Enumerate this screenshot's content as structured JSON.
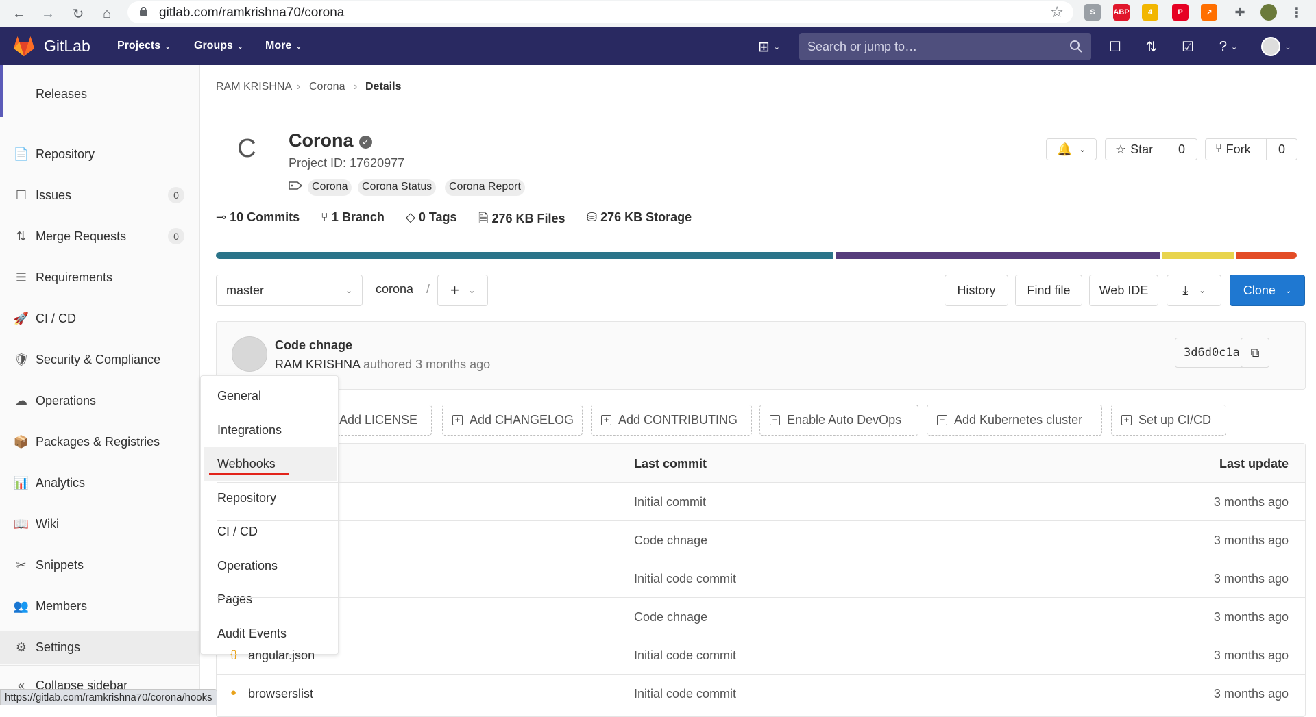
{
  "browser": {
    "url": "gitlab.com/ramkrishna70/corona",
    "status_url": "https://gitlab.com/ramkrishna70/corona/hooks",
    "extensions": [
      {
        "name": "skype-extension-icon",
        "label": "S",
        "color": "#9aa0a6"
      },
      {
        "name": "adblock-plus-icon",
        "label": "ABP",
        "color": "#e0162b"
      },
      {
        "name": "extension-badge-icon",
        "label": "4",
        "color": "#f2b600"
      },
      {
        "name": "pinterest-icon",
        "label": "P",
        "color": "#e60023"
      },
      {
        "name": "chart-extension-icon",
        "label": "↗",
        "color": "#ff6f00"
      }
    ]
  },
  "header": {
    "logo_text": "GitLab",
    "nav": [
      "Projects",
      "Groups",
      "More"
    ],
    "search_placeholder": "Search or jump to…"
  },
  "sidebar": {
    "top_partial": "Releases",
    "items": [
      {
        "name": "repository",
        "label": "Repository",
        "icon": "📄"
      },
      {
        "name": "issues",
        "label": "Issues",
        "icon": "☐",
        "count": "0"
      },
      {
        "name": "merge-requests",
        "label": "Merge Requests",
        "icon": "⇅",
        "count": "0"
      },
      {
        "name": "requirements",
        "label": "Requirements",
        "icon": "☰"
      },
      {
        "name": "ci-cd",
        "label": "CI / CD",
        "icon": "🚀"
      },
      {
        "name": "security-compliance",
        "label": "Security & Compliance",
        "icon": "🛡"
      },
      {
        "name": "operations",
        "label": "Operations",
        "icon": "☁"
      },
      {
        "name": "packages-registries",
        "label": "Packages & Registries",
        "icon": "📦"
      },
      {
        "name": "analytics",
        "label": "Analytics",
        "icon": "📊"
      },
      {
        "name": "wiki",
        "label": "Wiki",
        "icon": "📖"
      },
      {
        "name": "snippets",
        "label": "Snippets",
        "icon": "✂"
      },
      {
        "name": "members",
        "label": "Members",
        "icon": "👥"
      },
      {
        "name": "settings",
        "label": "Settings",
        "icon": "⚙"
      }
    ],
    "collapse_label": "Collapse sidebar"
  },
  "flyout": {
    "items": [
      "General",
      "Integrations",
      "Webhooks",
      "Repository",
      "CI / CD",
      "Operations",
      "Pages",
      "Audit Events"
    ]
  },
  "breadcrumb": [
    "RAM KRISHNA",
    "Corona",
    "Details"
  ],
  "project": {
    "avatar_letter": "C",
    "name": "Corona",
    "id_text": "Project ID: 17620977",
    "topics": [
      "Corona",
      "Corona Status",
      "Corona Report"
    ],
    "star_label": "Star",
    "star_count": "0",
    "fork_label": "Fork",
    "fork_count": "0"
  },
  "stats": [
    {
      "value": "10",
      "label": "Commits"
    },
    {
      "value": "1",
      "label": "Branch"
    },
    {
      "value": "0",
      "label": "Tags"
    },
    {
      "value": "276 KB",
      "label": "Files"
    },
    {
      "value": "276 KB",
      "label": "Storage"
    }
  ],
  "languages": [
    {
      "color": "#2b7489",
      "share": 0.57
    },
    {
      "color": "#563d7c",
      "share": 0.3
    },
    {
      "color": "#e8d44d",
      "share": 0.066
    },
    {
      "color": "#e34c26",
      "share": 0.056
    }
  ],
  "toolbar": {
    "branch": "master",
    "path": "corona",
    "path_sep": "/",
    "history": "History",
    "find_file": "Find file",
    "web_ide": "Web IDE",
    "clone": "Clone"
  },
  "last_commit": {
    "title": "Code chnage",
    "author": "RAM KRISHNA",
    "meta": "authored 3 months ago",
    "sha": "3d6d0c1a"
  },
  "add_buttons": [
    "Add LICENSE",
    "Add CHANGELOG",
    "Add CONTRIBUTING",
    "Enable Auto DevOps",
    "Add Kubernetes cluster",
    "Set up CI/CD"
  ],
  "table": {
    "col_last_commit": "Last commit",
    "col_last_update": "Last update",
    "rows": [
      {
        "name": "",
        "commit": "Initial commit",
        "date": "3 months ago"
      },
      {
        "name": "",
        "commit": "Code chnage",
        "date": "3 months ago"
      },
      {
        "name": "",
        "commit": "Initial code commit",
        "date": "3 months ago"
      },
      {
        "name": "",
        "commit": "Code chnage",
        "date": "3 months ago"
      },
      {
        "name": "angular.json",
        "commit": "Initial code commit",
        "date": "3 months ago"
      },
      {
        "name": "browserslist",
        "commit": "Initial code commit",
        "date": "3 months ago"
      }
    ]
  }
}
